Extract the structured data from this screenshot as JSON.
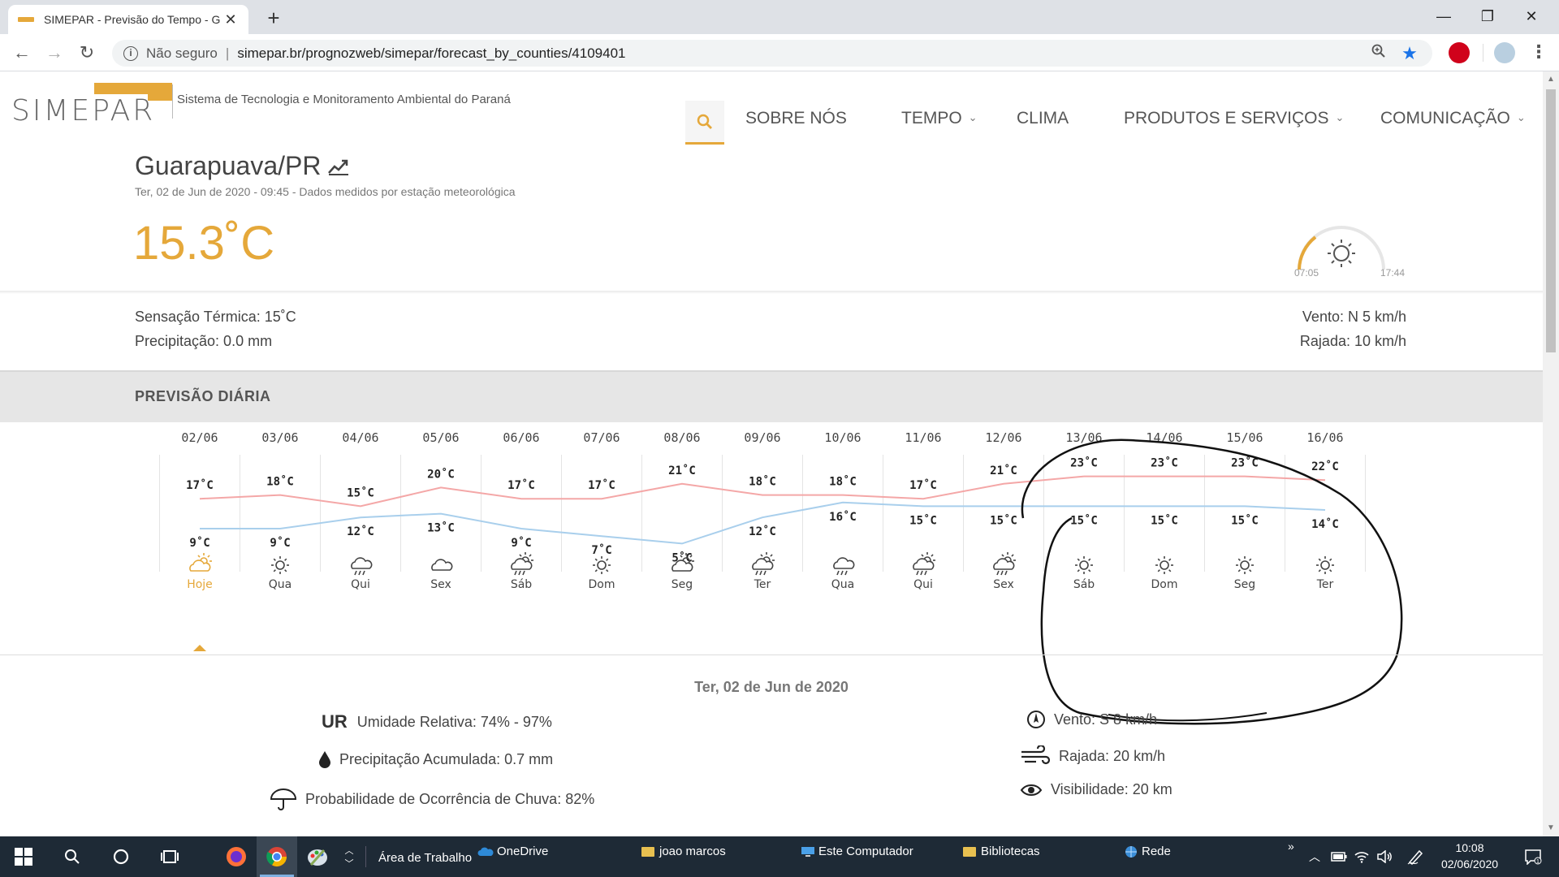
{
  "browser": {
    "tab_title": "SIMEPAR - Previsão do Tempo - G",
    "not_secure": "Não seguro",
    "url": "simepar.br/prognozweb/simepar/forecast_by_counties/4109401"
  },
  "header": {
    "logo_text": "SIMEPAR",
    "tagline": "Sistema de Tecnologia e Monitoramento Ambiental do Paraná",
    "nav": [
      "SOBRE NÓS",
      "TEMPO",
      "CLIMA",
      "PRODUTOS E SERVIÇOS",
      "COMUNICAÇÃO"
    ]
  },
  "current": {
    "city": "Guarapuava/PR",
    "subline": "Ter, 02 de Jun de 2020 - 09:45 - Dados medidos por estação meteorológica",
    "temperature": "15.3˚C",
    "sunrise": "07:05",
    "sunset": "17:44",
    "sensacao": "Sensação Térmica: 15˚C",
    "precipitacao": "Precipitação: 0.0 mm",
    "vento": "Vento: N 5 km/h",
    "rajada": "Rajada: 10 km/h"
  },
  "forecast": {
    "section_title": "PREVISÃO DIÁRIA",
    "days": [
      {
        "date": "02/06",
        "max": 17,
        "min": 9,
        "label": "Hoje",
        "icon": "sun-cloud-icon"
      },
      {
        "date": "03/06",
        "max": 18,
        "min": 9,
        "label": "Qua",
        "icon": "sun-icon"
      },
      {
        "date": "04/06",
        "max": 15,
        "min": 12,
        "label": "Qui",
        "icon": "rain-icon"
      },
      {
        "date": "05/06",
        "max": 20,
        "min": 13,
        "label": "Sex",
        "icon": "cloud-icon"
      },
      {
        "date": "06/06",
        "max": 17,
        "min": 9,
        "label": "Sáb",
        "icon": "sun-rain-icon"
      },
      {
        "date": "07/06",
        "max": 17,
        "min": 7,
        "label": "Dom",
        "icon": "sun-icon"
      },
      {
        "date": "08/06",
        "max": 21,
        "min": 5,
        "label": "Seg",
        "icon": "sun-cloud-icon"
      },
      {
        "date": "09/06",
        "max": 18,
        "min": 12,
        "label": "Ter",
        "icon": "sun-rain-icon"
      },
      {
        "date": "10/06",
        "max": 18,
        "min": 16,
        "label": "Qua",
        "icon": "rain-icon"
      },
      {
        "date": "11/06",
        "max": 17,
        "min": 15,
        "label": "Qui",
        "icon": "sun-rain-icon"
      },
      {
        "date": "12/06",
        "max": 21,
        "min": 15,
        "label": "Sex",
        "icon": "sun-rain-icon"
      },
      {
        "date": "13/06",
        "max": 23,
        "min": 15,
        "label": "Sáb",
        "icon": "sun-icon"
      },
      {
        "date": "14/06",
        "max": 23,
        "min": 15,
        "label": "Dom",
        "icon": "sun-icon"
      },
      {
        "date": "15/06",
        "max": 23,
        "min": 15,
        "label": "Seg",
        "icon": "sun-icon"
      },
      {
        "date": "16/06",
        "max": 22,
        "min": 14,
        "label": "Ter",
        "icon": "sun-icon"
      }
    ],
    "unit": "˚C",
    "max_color": "#f4a7a7",
    "min_color": "#a9cfec",
    "accent": "#e5a83a"
  },
  "detail": {
    "heading": "Ter, 02 de Jun de 2020",
    "ur_label": "UR",
    "umidade": "Umidade Relativa: 74% - 97%",
    "precip": "Precipitação Acumulada: 0.7 mm",
    "prob_chuva": "Probabilidade de Ocorrência de Chuva: 82%",
    "vento": "Vento: S 8 km/h",
    "rajada": "Rajada: 20 km/h",
    "visibilidade": "Visibilidade: 20 km"
  },
  "taskbar": {
    "desktop": "Área de Trabalho",
    "onedrive": "OneDrive",
    "folder_user": "joao marcos",
    "this_pc": "Este Computador",
    "libraries": "Bibliotecas",
    "network": "Rede",
    "time": "10:08",
    "date": "02/06/2020"
  }
}
